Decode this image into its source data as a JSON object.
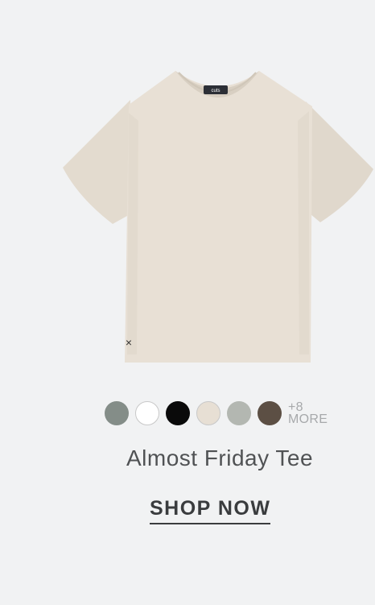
{
  "product": {
    "name": "Almost Friday Tee",
    "neck_label": "cuts",
    "color": "#e8e0d5"
  },
  "swatches": [
    {
      "name": "sage",
      "color": "#848d88"
    },
    {
      "name": "white",
      "color": "#ffffff"
    },
    {
      "name": "black",
      "color": "#0a0a0a"
    },
    {
      "name": "bone",
      "color": "#e7dfd4"
    },
    {
      "name": "light-sage",
      "color": "#b3b7b1"
    },
    {
      "name": "brown",
      "color": "#5c4f44"
    }
  ],
  "more": {
    "count": "+8",
    "label": "MORE"
  },
  "cta": {
    "label": "SHOP NOW"
  }
}
